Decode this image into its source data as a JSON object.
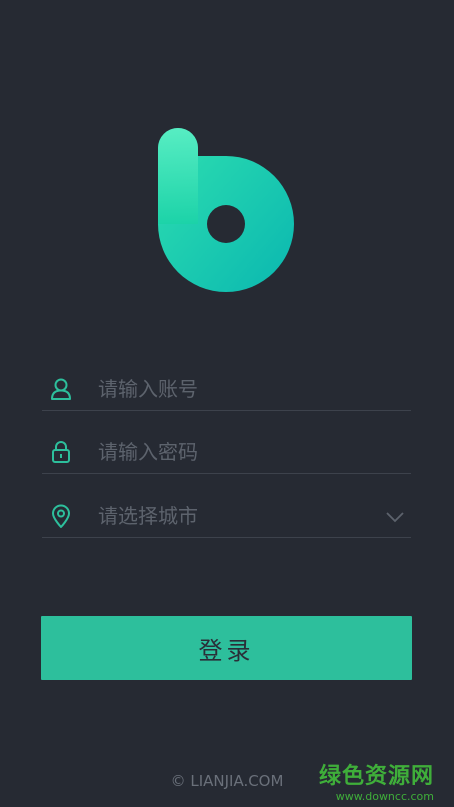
{
  "app": {
    "logo_icon": "brand-b-logo-icon",
    "accent_color": "#2dbf9c",
    "background_color": "#262a33"
  },
  "login_form": {
    "account_field": {
      "icon": "user-icon",
      "placeholder": "请输入账号"
    },
    "password_field": {
      "icon": "lock-icon",
      "placeholder": "请输入密码"
    },
    "city_field": {
      "icon": "location-pin-icon",
      "placeholder": "请选择城市",
      "dropdown_icon": "chevron-down-icon"
    },
    "login_button_label": "登录"
  },
  "footer": {
    "copyright": "© LIANJIA.COM"
  },
  "watermark": {
    "site_name": "绿色资源网",
    "url": "www.downcc.com"
  }
}
